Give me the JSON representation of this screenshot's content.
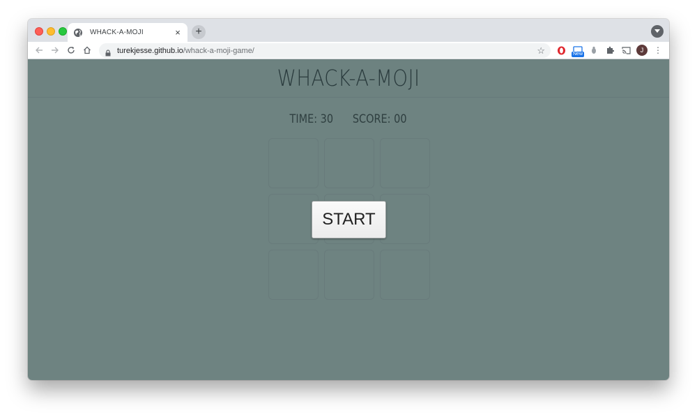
{
  "browser": {
    "tab": {
      "title": "WHACK-A-MOJI",
      "close_glyph": "×",
      "favicon_icon": "globe-icon"
    },
    "new_tab_glyph": "+",
    "url": {
      "domain": "turekjesse.github.io",
      "path": "/whack-a-moji-game/"
    },
    "extensions": {
      "new_badge": "New",
      "avatar_initial": "J"
    }
  },
  "game": {
    "title": "WHACK-A-MOJI",
    "time_label": "TIME: 30",
    "score_label": "SCORE: 00",
    "start_label": "START",
    "grid": {
      "rows": 3,
      "cols": 3
    }
  },
  "colors": {
    "page_background": "#6e8381",
    "title_text": "#2a3b3d",
    "chrome_tabstrip": "#dee1e6"
  }
}
